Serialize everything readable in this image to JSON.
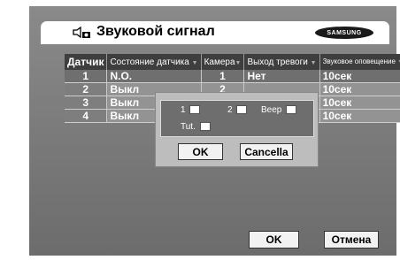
{
  "header": {
    "title": "Звуковой сигнал",
    "brand": "SAMSUNG",
    "icon": "speaker-camera-icon"
  },
  "table": {
    "columns": [
      "Датчик",
      "Состояние датчика",
      "Камера",
      "Выход тревоги",
      "Звуковое оповещение"
    ],
    "rows": [
      [
        "1",
        "N.O.",
        "1",
        "Нет",
        "10сек"
      ],
      [
        "2",
        "Выкл",
        "2",
        "",
        "10сек"
      ],
      [
        "3",
        "Выкл",
        "",
        "",
        "10сек"
      ],
      [
        "4",
        "Выкл",
        "",
        "",
        "10сек"
      ]
    ]
  },
  "popup": {
    "labels": [
      "1",
      "2",
      "Beep",
      "Tut."
    ],
    "ok_label": "OK",
    "cancel_label": "Cancella"
  },
  "footer": {
    "ok_label": "OK",
    "cancel_label": "Отмена"
  }
}
